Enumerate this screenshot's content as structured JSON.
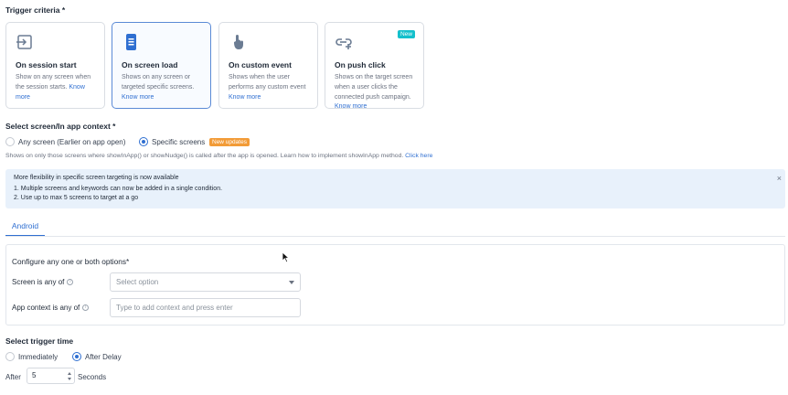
{
  "trigger": {
    "title": "Trigger criteria *",
    "cards": [
      {
        "icon": "session-start-icon",
        "title": "On session start",
        "desc": "Show on any screen when the session starts.",
        "link": "Know more"
      },
      {
        "icon": "screen-load-icon",
        "title": "On screen load",
        "desc": "Shows on any screen or targeted specific screens.",
        "link": "Know more"
      },
      {
        "icon": "tap-hand-icon",
        "title": "On custom event",
        "desc": "Shows when the user performs any custom event",
        "link": "Know more"
      },
      {
        "icon": "push-link-icon",
        "title": "On push click",
        "desc": "Shows on the target screen when a user clicks the connected push campaign.",
        "link": "Know more",
        "badge": "New"
      }
    ]
  },
  "context": {
    "title": "Select screen/In app context *",
    "option_any": "Any screen (Earlier on app open)",
    "option_specific": "Specific screens",
    "badge": "New updates",
    "helper": "Shows on only those screens where showInApp() or showNudge() is called after the app is opened. Learn how to implement showInApp method.",
    "helper_link": "Click here"
  },
  "banner": {
    "title": "More flexibility in specific screen targeting is now available",
    "line1": "1. Multiple screens and keywords can now be added in a single condition.",
    "line2": "2. Use up to max 5 screens to target at a go",
    "close": "×"
  },
  "tabs": {
    "android": "Android"
  },
  "config": {
    "title": "Configure any one or both options*",
    "screen_label": "Screen is any of",
    "screen_placeholder": "Select option",
    "context_label": "App context is any of",
    "context_placeholder": "Type to add context and press enter",
    "info": "i"
  },
  "timing": {
    "title": "Select trigger time",
    "option_immediately": "Immediately",
    "option_delay": "After Delay",
    "after_label": "After",
    "delay_value": "5",
    "unit_label": "Seconds"
  },
  "colors": {
    "accent": "#2f6fd1",
    "badge_new": "#14c0cc",
    "badge_update": "#f29b37",
    "banner_bg": "#e8f1fb"
  }
}
